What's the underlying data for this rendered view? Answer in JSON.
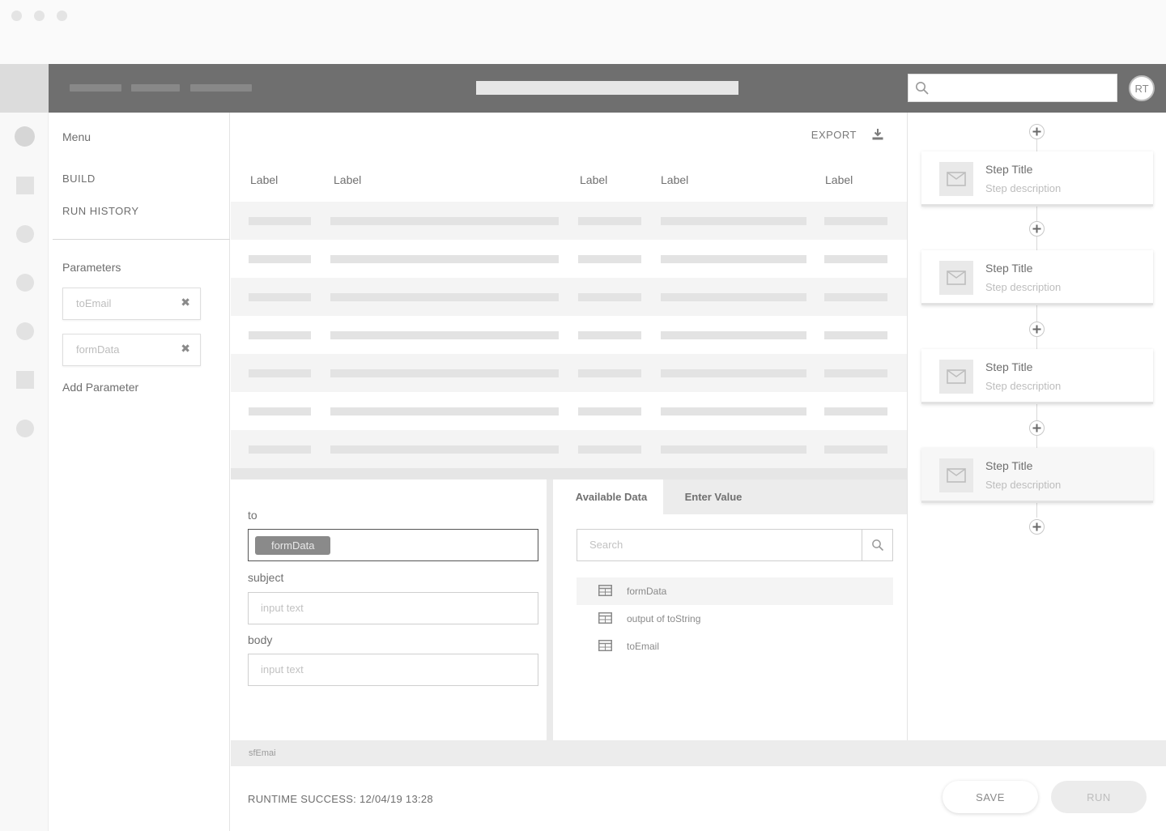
{
  "header": {
    "avatar_initials": "RT",
    "search_placeholder": ""
  },
  "menu": {
    "title": "Menu",
    "items": [
      {
        "label": "BUILD"
      },
      {
        "label": "RUN HISTORY"
      }
    ]
  },
  "parameters": {
    "title": "Parameters",
    "items": [
      {
        "name": "toEmail"
      },
      {
        "name": "formData"
      }
    ],
    "add_label": "Add Parameter"
  },
  "table": {
    "export_label": "EXPORT",
    "columns": [
      "Label",
      "Label",
      "Label",
      "Label",
      "Label"
    ]
  },
  "form": {
    "to_label": "to",
    "to_tag": "formData",
    "subject_label": "subject",
    "subject_placeholder": "input text",
    "body_label": "body",
    "body_placeholder": "input text"
  },
  "data_picker": {
    "tabs": [
      {
        "label": "Available Data",
        "active": true
      },
      {
        "label": "Enter Value",
        "active": false
      }
    ],
    "search_placeholder": "Search",
    "items": [
      {
        "label": "formData",
        "selected": true
      },
      {
        "label": "output of toString",
        "selected": false
      },
      {
        "label": "toEmail",
        "selected": false
      }
    ]
  },
  "status": {
    "gutter_text": "sfEmai",
    "runtime": "RUNTIME SUCCESS: 12/04/19 13:28",
    "save_label": "SAVE",
    "run_label": "RUN"
  },
  "steps": [
    {
      "title": "Step Title",
      "description": "Step description",
      "selected": false
    },
    {
      "title": "Step Title",
      "description": "Step description",
      "selected": false
    },
    {
      "title": "Step Title",
      "description": "Step description",
      "selected": false
    },
    {
      "title": "Step Title",
      "description": "Step description",
      "selected": true
    }
  ],
  "colors": {
    "header_bg": "#6f6f6f",
    "panel_border": "#e4e4e4",
    "placeholder_bar": "#e3e3e3"
  }
}
